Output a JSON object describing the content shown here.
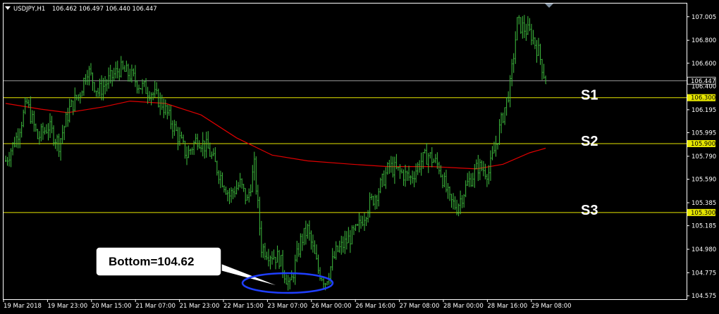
{
  "header": {
    "symbol": "USDJPY,H1",
    "ohlc": "106.462 106.497 106.440 106.447"
  },
  "colors": {
    "background": "#000000",
    "frame": "#ffffff",
    "candle": "#3fbf3f",
    "ma": "#e00000",
    "support": "#e6e600",
    "current": "#9a9a9a",
    "callout_ellipse": "#1f3fff"
  },
  "chart_data": {
    "type": "candlestick",
    "symbol": "USDJPY",
    "timeframe": "H1",
    "y_ticks": [
      "107.005",
      "106.800",
      "106.600",
      "106.195",
      "105.995",
      "105.790",
      "105.590",
      "105.385",
      "105.185",
      "104.980",
      "104.775",
      "104.575"
    ],
    "ylim": [
      104.545,
      107.12
    ],
    "x_ticks": [
      "19 Mar 2018",
      "19 Mar 23:00",
      "20 Mar 15:00",
      "21 Mar 07:00",
      "21 Mar 23:00",
      "22 Mar 15:00",
      "23 Mar 07:00",
      "26 Mar 00:00",
      "26 Mar 16:00",
      "27 Mar 08:00",
      "28 Mar 00:00",
      "28 Mar 16:00",
      "29 Mar 08:00"
    ],
    "current_price": "106.447",
    "hidden_price": "106.400",
    "levels": [
      {
        "name": "S1",
        "price": 106.3,
        "label": "106.300"
      },
      {
        "name": "S2",
        "price": 105.9,
        "label": "105.900"
      },
      {
        "name": "S3",
        "price": 105.3,
        "label": "105.300"
      }
    ],
    "path": [
      [
        0,
        105.75
      ],
      [
        6,
        105.95
      ],
      [
        12,
        106.25
      ],
      [
        18,
        105.95
      ],
      [
        24,
        106.05
      ],
      [
        30,
        105.9
      ],
      [
        36,
        106.2
      ],
      [
        42,
        106.35
      ],
      [
        46,
        106.55
      ],
      [
        52,
        106.35
      ],
      [
        58,
        106.45
      ],
      [
        64,
        106.55
      ],
      [
        70,
        106.5
      ],
      [
        76,
        106.4
      ],
      [
        82,
        106.35
      ],
      [
        88,
        106.25
      ],
      [
        96,
        106.0
      ],
      [
        102,
        105.8
      ],
      [
        108,
        105.95
      ],
      [
        114,
        105.85
      ],
      [
        120,
        105.65
      ],
      [
        126,
        105.45
      ],
      [
        132,
        105.55
      ],
      [
        136,
        105.4
      ],
      [
        140,
        105.7
      ],
      [
        144,
        105.0
      ],
      [
        148,
        104.95
      ],
      [
        154,
        104.9
      ],
      [
        160,
        104.65
      ],
      [
        166,
        105.05
      ],
      [
        170,
        105.15
      ],
      [
        176,
        104.8
      ],
      [
        180,
        104.7
      ],
      [
        186,
        104.95
      ],
      [
        192,
        105.05
      ],
      [
        198,
        105.15
      ],
      [
        204,
        105.35
      ],
      [
        210,
        105.5
      ],
      [
        216,
        105.7
      ],
      [
        222,
        105.65
      ],
      [
        228,
        105.6
      ],
      [
        234,
        105.75
      ],
      [
        238,
        105.8
      ],
      [
        244,
        105.7
      ],
      [
        250,
        105.4
      ],
      [
        254,
        105.35
      ],
      [
        260,
        105.55
      ],
      [
        266,
        105.7
      ],
      [
        272,
        105.65
      ],
      [
        276,
        105.9
      ],
      [
        280,
        106.15
      ],
      [
        284,
        106.4
      ],
      [
        288,
        106.95
      ],
      [
        292,
        106.9
      ],
      [
        296,
        106.85
      ],
      [
        300,
        106.7
      ],
      [
        304,
        106.45
      ]
    ],
    "ma": [
      [
        0,
        106.25
      ],
      [
        20,
        106.2
      ],
      [
        35,
        106.17
      ],
      [
        55,
        106.22
      ],
      [
        70,
        106.27
      ],
      [
        90,
        106.25
      ],
      [
        110,
        106.15
      ],
      [
        130,
        105.95
      ],
      [
        150,
        105.8
      ],
      [
        170,
        105.75
      ],
      [
        195,
        105.72
      ],
      [
        215,
        105.7
      ],
      [
        240,
        105.7
      ],
      [
        265,
        105.68
      ],
      [
        280,
        105.72
      ],
      [
        295,
        105.82
      ],
      [
        304,
        105.86
      ]
    ],
    "annotations": [
      {
        "type": "callout",
        "text": "Bottom=104.62",
        "price": 104.62
      }
    ]
  }
}
